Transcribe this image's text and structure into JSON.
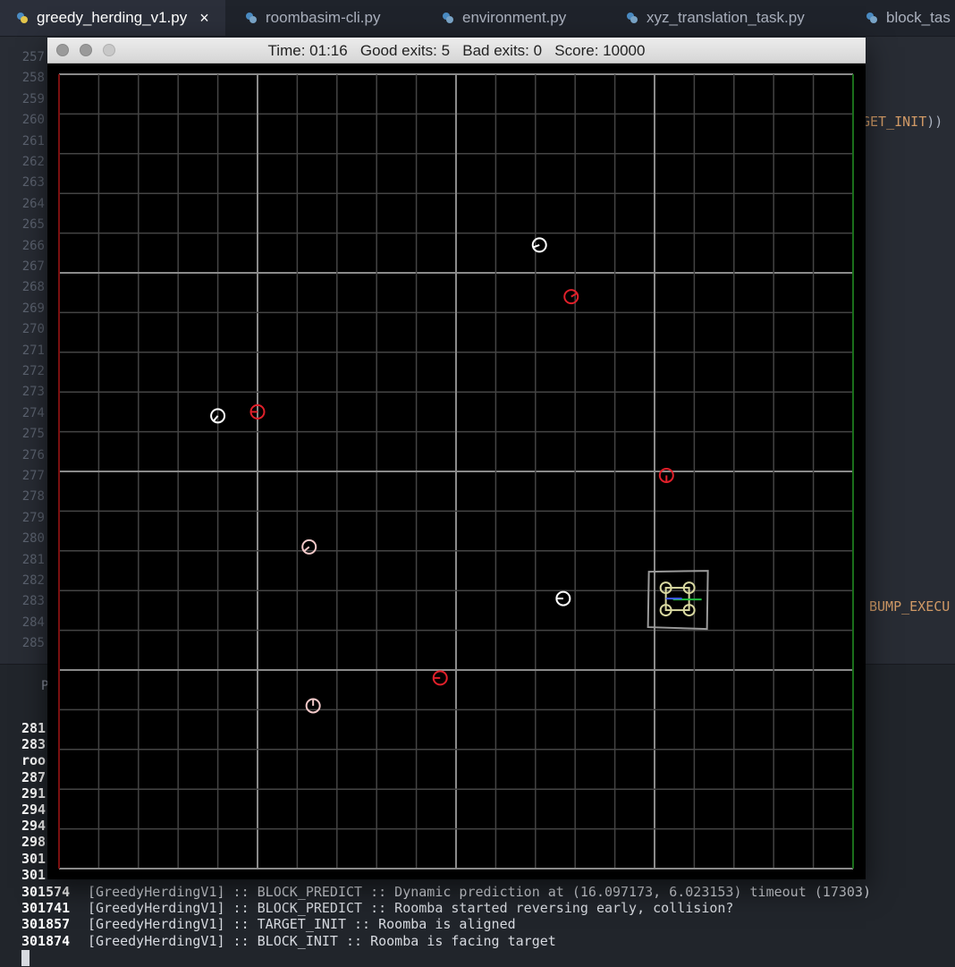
{
  "tabs": [
    {
      "label": "greedy_herding_v1.py",
      "active": true,
      "close_icon": "×"
    },
    {
      "label": "roombasim-cli.py"
    },
    {
      "label": "environment.py"
    },
    {
      "label": "xyz_translation_task.py"
    },
    {
      "label": "block_tas"
    }
  ],
  "editor": {
    "line_numbers": [
      "257",
      "258",
      "259",
      "260",
      "261",
      "262",
      "263",
      "264",
      "265",
      "266",
      "267",
      "268",
      "269",
      "270",
      "271",
      "272",
      "273",
      "274",
      "275",
      "276",
      "277",
      "278",
      "279",
      "280",
      "281",
      "282",
      "283",
      "284",
      "285"
    ],
    "fragments": {
      "line_260_text": "GET_INIT",
      "line_260_tail": "))",
      "line_283_text": "BUMP_EXECU"
    }
  },
  "terminal": {
    "panel_tab": "P",
    "partial_ids": [
      "281",
      "283",
      "roo",
      "287",
      "291",
      "294",
      "294",
      "298",
      "301",
      "301"
    ],
    "lines": [
      {
        "id": "301574",
        "text": "[GreedyHerdingV1] :: BLOCK_PREDICT :: Dynamic prediction at (16.097173, 6.023153) timeout (17303)"
      },
      {
        "id": "301741",
        "text": "[GreedyHerdingV1] :: BLOCK_PREDICT :: Roomba started reversing early, collision?"
      },
      {
        "id": "301857",
        "text": "[GreedyHerdingV1] :: TARGET_INIT :: Roomba is aligned"
      },
      {
        "id": "301874",
        "text": "[GreedyHerdingV1] :: BLOCK_INIT :: Roomba is facing target"
      }
    ]
  },
  "sim": {
    "title_parts": {
      "time_label": "Time:",
      "time": "01:16",
      "good_label": "Good exits:",
      "good": "5",
      "bad_label": "Bad exits:",
      "bad": "0",
      "score_label": "Score:",
      "score": "10000"
    },
    "colors": {
      "grid_minor": "#444444",
      "grid_major": "#8a8a8a",
      "left_edge": "#7a1010",
      "right_edge": "#1a6e1a",
      "roomba_white": "#ffffff",
      "roomba_red": "#e0202a",
      "roomba_pink": "#f2c8c8",
      "drone_box": "#9a9a9a",
      "drone_rotors": "#d8d8a0",
      "drone_heading": "#20c040",
      "drone_center": "#4060ff"
    },
    "grid": {
      "cells": 20,
      "major_every": 5
    },
    "roombas": [
      {
        "x": 12.1,
        "y": 15.7,
        "color": "white",
        "heading_deg": 200
      },
      {
        "x": 12.9,
        "y": 14.4,
        "color": "red",
        "heading_deg": 30
      },
      {
        "x": 4.0,
        "y": 11.4,
        "color": "white",
        "heading_deg": 230
      },
      {
        "x": 5.0,
        "y": 11.5,
        "color": "red",
        "heading_deg": 180
      },
      {
        "x": 15.3,
        "y": 9.9,
        "color": "red",
        "heading_deg": 270
      },
      {
        "x": 6.3,
        "y": 8.1,
        "color": "pink",
        "heading_deg": 220
      },
      {
        "x": 12.7,
        "y": 6.8,
        "color": "white",
        "heading_deg": 180
      },
      {
        "x": 9.6,
        "y": 4.8,
        "color": "red",
        "heading_deg": 180
      },
      {
        "x": 6.4,
        "y": 4.1,
        "color": "pink",
        "heading_deg": 90
      }
    ],
    "drone": {
      "x": 15.6,
      "y": 6.8
    }
  }
}
